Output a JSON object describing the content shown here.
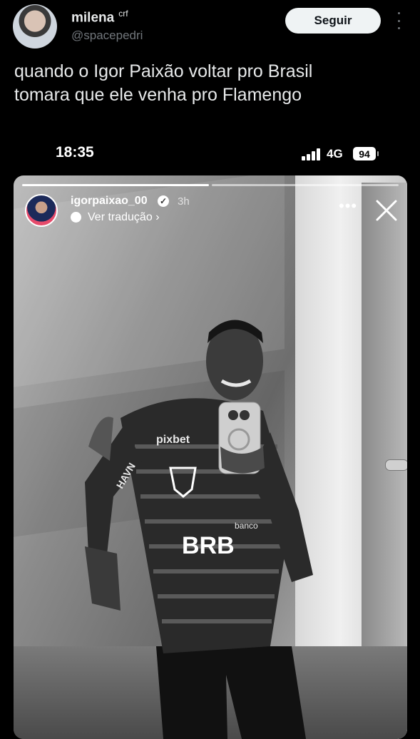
{
  "tweet": {
    "name": "milena",
    "name_suffix": "crf",
    "handle": "@spacepedri",
    "follow_label": "Seguir",
    "text_lines": [
      "quando o Igor Paixão voltar pro Brasil",
      "tomara que ele venha pro Flamengo"
    ]
  },
  "phone_status": {
    "time": "18:35",
    "network": "4G",
    "battery": "94"
  },
  "story": {
    "username": "igorpaixao_00",
    "time_ago": "3h",
    "translate_label": "Ver tradução",
    "translate_chevron": "›",
    "more_label": "•••",
    "jersey_text": [
      "pixbet",
      "BRB",
      "banco",
      "HAVN"
    ]
  },
  "icons": {
    "verified": "verified-badge-icon",
    "translate": "translate-icon",
    "close": "close-icon",
    "more": "more-icon"
  },
  "colors": {
    "background": "#000000",
    "follow_button": "#eff3f4",
    "secondary_text": "#71767b"
  }
}
